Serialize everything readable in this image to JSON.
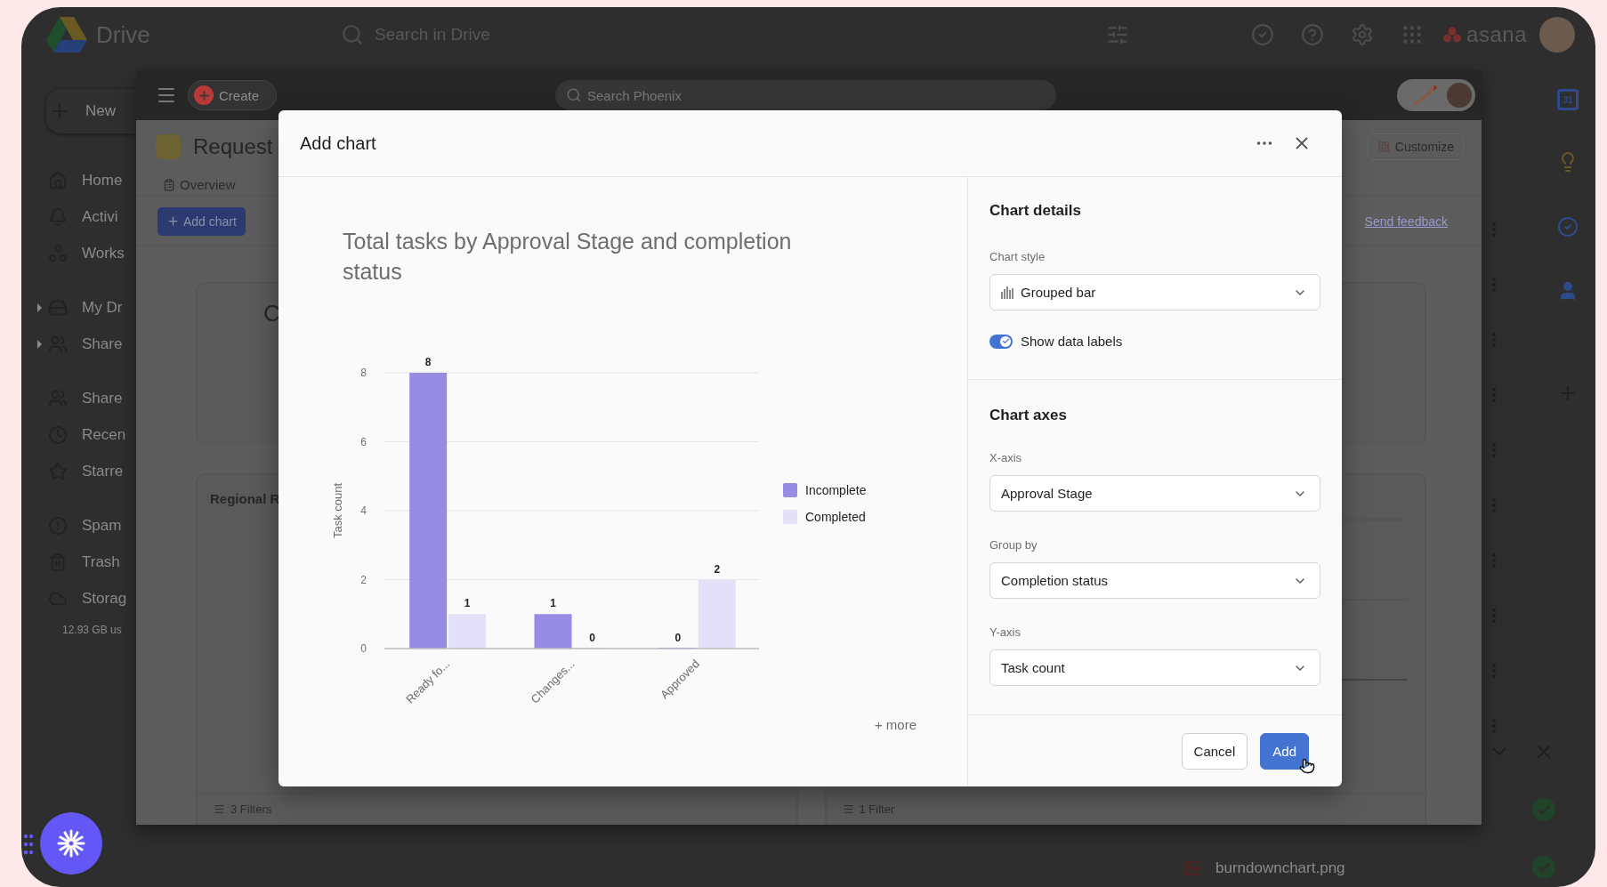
{
  "drive": {
    "app_name": "Drive",
    "search_placeholder": "Search in Drive",
    "brand": "asana",
    "new_label": "New",
    "nav_groups": [
      [
        {
          "label": "Home",
          "expandable": false
        },
        {
          "label": "Activi",
          "expandable": false
        },
        {
          "label": "Works",
          "expandable": false
        }
      ],
      [
        {
          "label": "My Dr",
          "expandable": true
        },
        {
          "label": "Share",
          "expandable": true
        }
      ],
      [
        {
          "label": "Share",
          "expandable": false
        },
        {
          "label": "Recen",
          "expandable": false
        },
        {
          "label": "Starre",
          "expandable": false
        }
      ],
      [
        {
          "label": "Spam",
          "expandable": false
        },
        {
          "label": "Trash",
          "expandable": false
        },
        {
          "label": "Storag",
          "expandable": false
        }
      ]
    ],
    "storage_usage": "12.93 GB us",
    "rail_calendar_day": "31",
    "upload_file": "burndownchart.png"
  },
  "project_window": {
    "create_label": "Create",
    "search_placeholder": "Search Phoenix",
    "project_title": "Request",
    "tabs": [
      {
        "label": "Overview"
      }
    ],
    "add_chart_label": "Add chart",
    "customize_label": "Customize",
    "feedback_link": "Send feedback",
    "left_cards": [
      {
        "title": "C"
      },
      {
        "title": "Regional R",
        "filters": "3 Filters"
      }
    ],
    "right_filters": "1 Filter"
  },
  "dialog": {
    "title": "Add chart",
    "more_link": "+ more",
    "chart_data": {
      "type": "bar",
      "title": "Total tasks by Approval Stage and completion status",
      "ylabel": "Task count",
      "categories": [
        "Ready fo...",
        "Changes...",
        "Approved"
      ],
      "series": [
        {
          "name": "Incomplete",
          "color": "#978ce4",
          "values": [
            8,
            1,
            0
          ]
        },
        {
          "name": "Completed",
          "color": "#e3e0f8",
          "values": [
            1,
            0,
            2
          ]
        }
      ],
      "ylim": [
        0,
        8
      ],
      "yticks": [
        0,
        2,
        4,
        6,
        8
      ],
      "data_labels": true,
      "grid": true,
      "legend": true
    },
    "details": {
      "heading": "Chart details",
      "style_label": "Chart style",
      "style_value": "Grouped bar",
      "toggle": {
        "label": "Show data labels",
        "on": true
      }
    },
    "axes": {
      "heading": "Chart axes",
      "fields": [
        {
          "label": "X-axis",
          "value": "Approval Stage"
        },
        {
          "label": "Group by",
          "value": "Completion status"
        },
        {
          "label": "Y-axis",
          "value": "Task count"
        }
      ]
    },
    "buttons": [
      {
        "label": "Cancel",
        "kind": "secondary"
      },
      {
        "label": "Add",
        "kind": "primary"
      }
    ]
  }
}
